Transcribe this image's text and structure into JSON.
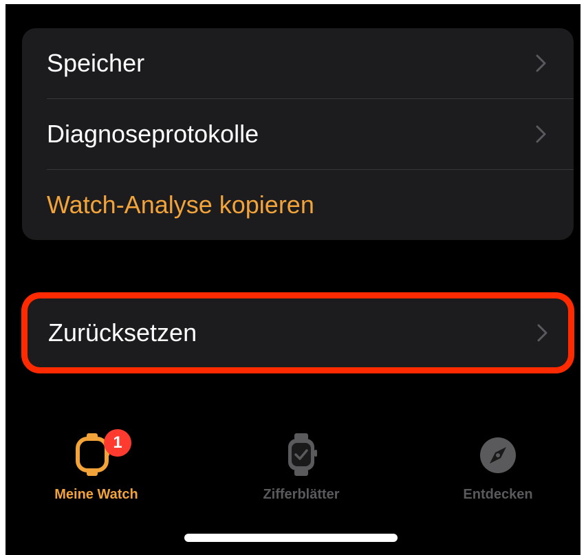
{
  "settings_group": {
    "items": [
      {
        "label": "Speicher"
      },
      {
        "label": "Diagnoseprotokolle"
      },
      {
        "label": "Watch-Analyse kopieren"
      }
    ]
  },
  "reset_item": {
    "label": "Zurücksetzen"
  },
  "tab_bar": {
    "tabs": [
      {
        "label": "Meine Watch",
        "icon": "watch-icon",
        "active": true,
        "badge": "1"
      },
      {
        "label": "Zifferblätter",
        "icon": "watch-face-icon",
        "active": false
      },
      {
        "label": "Entdecken",
        "icon": "compass-icon",
        "active": false
      }
    ]
  },
  "colors": {
    "accent": "#f2a33a",
    "badge": "#ff3b30",
    "highlight_outline": "#ff2a00",
    "background": "#000000",
    "cell": "#1c1c1e"
  }
}
